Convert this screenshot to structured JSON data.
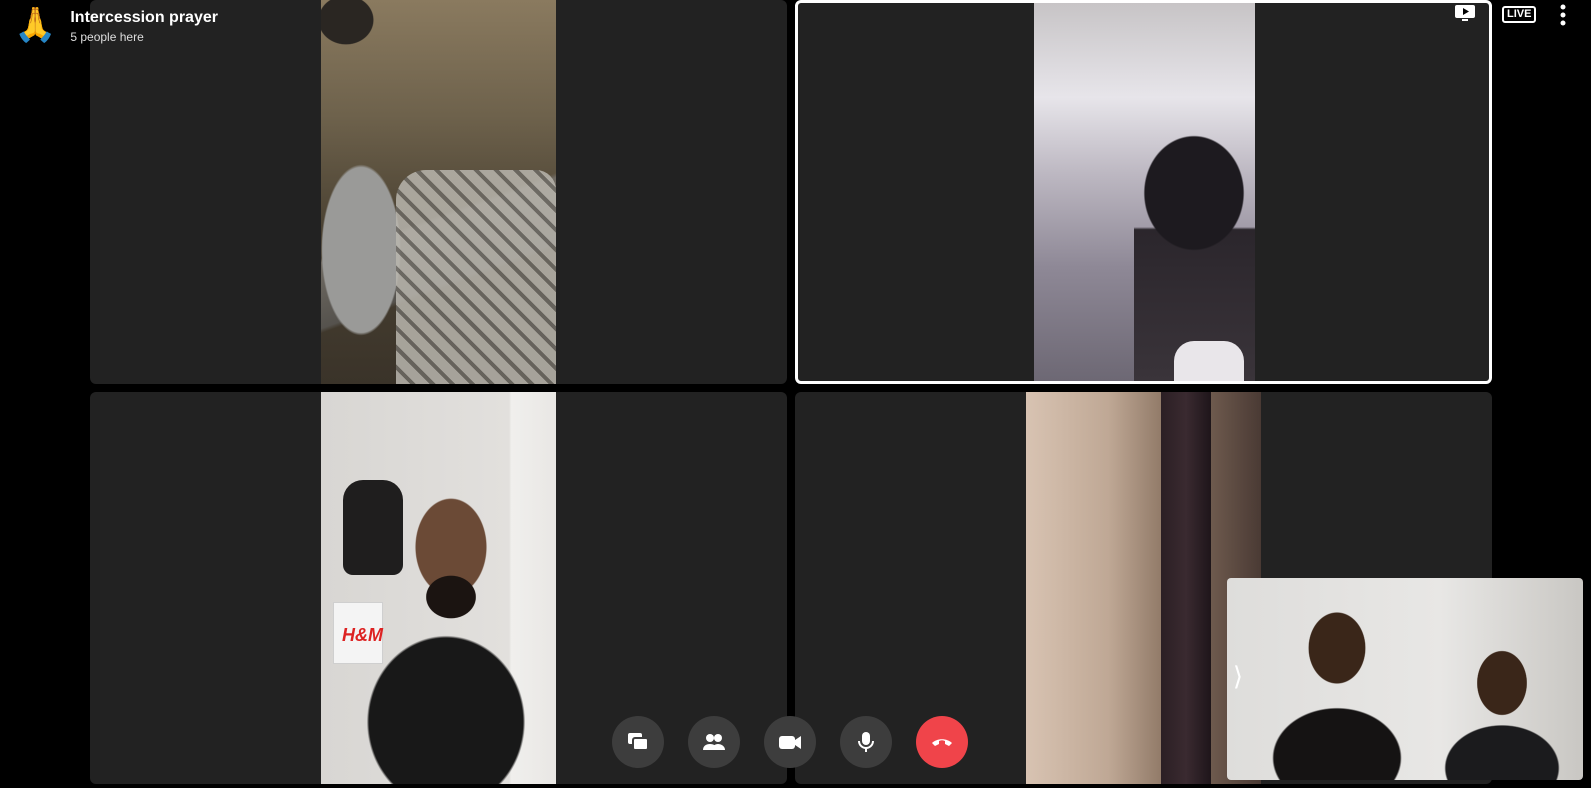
{
  "call": {
    "icon": "folded-hands-emoji",
    "icon_glyph": "🙏",
    "title": "Intercession prayer",
    "subtitle": "5 people here"
  },
  "top_bar": {
    "present_icon": "play-screen-icon",
    "live_badge": "LIVE",
    "more_icon": "more-vertical-icon"
  },
  "participants": [
    {
      "slot": "top-left",
      "active": false,
      "description_icon": "video-feed"
    },
    {
      "slot": "top-right",
      "active": true,
      "description_icon": "video-feed"
    },
    {
      "slot": "bottom-left",
      "active": false,
      "description_icon": "video-feed"
    },
    {
      "slot": "bottom-right",
      "active": false,
      "description_icon": "video-feed"
    }
  ],
  "self_view": {
    "toggle_glyph": "⟩"
  },
  "controls": [
    {
      "name": "screen-share-button",
      "icon": "screens-icon"
    },
    {
      "name": "participants-button",
      "icon": "people-icon"
    },
    {
      "name": "camera-button",
      "icon": "video-camera-icon"
    },
    {
      "name": "mic-button",
      "icon": "microphone-icon"
    },
    {
      "name": "end-call-button",
      "icon": "hang-up-icon",
      "color": "#f0444a"
    }
  ],
  "colors": {
    "background": "#000000",
    "tile": "#222222",
    "control": "#3d3d3d",
    "end_call": "#f0444a"
  }
}
